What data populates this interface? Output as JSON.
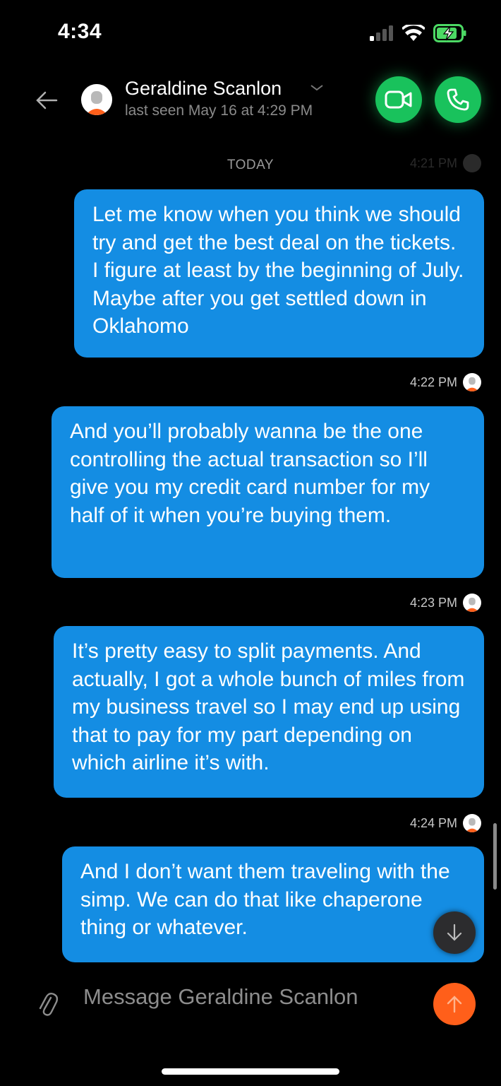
{
  "status_bar": {
    "time": "4:34"
  },
  "header": {
    "contact_name": "Geraldine Scanlon",
    "last_seen": "last seen May 16 at 4:29 PM",
    "accent": "#19c25c"
  },
  "chat": {
    "date_divider": "TODAY",
    "faint_time": "4:21 PM",
    "messages": [
      {
        "text": "Let me know when you think we should try and get the best deal on the tickets. I figure at least by the beginning of July. Maybe after you get settled down in Oklahomo",
        "time": "4:22 PM"
      },
      {
        "text": "And you’ll probably wanna be the one controlling the actual transaction so I’ll give you my credit card number for my half of it when you’re buying them.",
        "time": "4:23 PM"
      },
      {
        "text": "It’s pretty easy to split payments. And actually, I got a whole bunch of miles from my business travel so I may end up using that to pay for my part depending on which airline it’s with.",
        "time": "4:24 PM"
      },
      {
        "text": "And I don’t want them traveling with the simp. We can do that like chaperone thing or whatever.",
        "time": ""
      }
    ],
    "bubble_color": "#148de3"
  },
  "composer": {
    "placeholder": "Message Geraldine Scanlon",
    "send_color": "#ff5f1a"
  },
  "icons": {
    "back": "arrow-left-icon",
    "video": "video-camera-icon",
    "phone": "phone-icon",
    "attach": "paperclip-icon",
    "send": "arrow-up-icon",
    "scroll": "arrow-down-icon"
  }
}
